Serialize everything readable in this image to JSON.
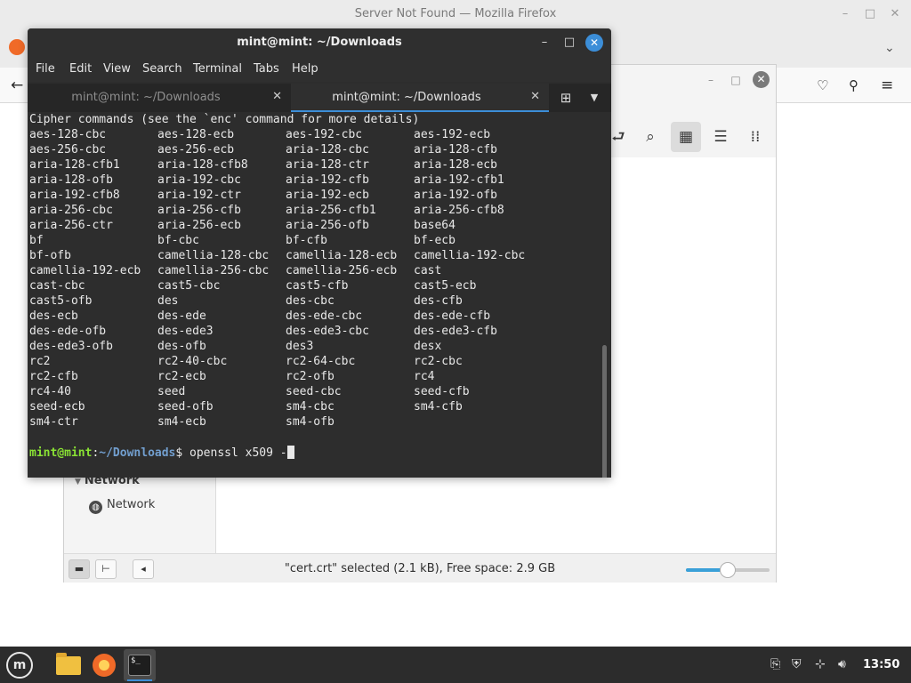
{
  "firefox": {
    "window_title": "Server Not Found — Mozilla Firefox",
    "titlebar_buttons": [
      "–",
      "□",
      "✕"
    ]
  },
  "file_manager": {
    "sidebar_section": "Network",
    "sidebar_item": "Network",
    "status_text": "\"cert.crt\" selected (2.1 kB), Free space: 2.9 GB",
    "zoom_level": 0.5
  },
  "terminal": {
    "window_title": "mint@mint: ~/Downloads",
    "menu": [
      "File",
      "Edit",
      "View",
      "Search",
      "Terminal",
      "Tabs",
      "Help"
    ],
    "tabs": [
      {
        "label": "mint@mint: ~/Downloads",
        "active": false
      },
      {
        "label": "mint@mint: ~/Downloads",
        "active": true
      }
    ],
    "header_line": "Cipher commands (see the `enc' command for more details)",
    "ciphers": [
      [
        "aes-128-cbc",
        "aes-128-ecb",
        "aes-192-cbc",
        "aes-192-ecb"
      ],
      [
        "aes-256-cbc",
        "aes-256-ecb",
        "aria-128-cbc",
        "aria-128-cfb"
      ],
      [
        "aria-128-cfb1",
        "aria-128-cfb8",
        "aria-128-ctr",
        "aria-128-ecb"
      ],
      [
        "aria-128-ofb",
        "aria-192-cbc",
        "aria-192-cfb",
        "aria-192-cfb1"
      ],
      [
        "aria-192-cfb8",
        "aria-192-ctr",
        "aria-192-ecb",
        "aria-192-ofb"
      ],
      [
        "aria-256-cbc",
        "aria-256-cfb",
        "aria-256-cfb1",
        "aria-256-cfb8"
      ],
      [
        "aria-256-ctr",
        "aria-256-ecb",
        "aria-256-ofb",
        "base64"
      ],
      [
        "bf",
        "bf-cbc",
        "bf-cfb",
        "bf-ecb"
      ],
      [
        "bf-ofb",
        "camellia-128-cbc",
        "camellia-128-ecb",
        "camellia-192-cbc"
      ],
      [
        "camellia-192-ecb",
        "camellia-256-cbc",
        "camellia-256-ecb",
        "cast"
      ],
      [
        "cast-cbc",
        "cast5-cbc",
        "cast5-cfb",
        "cast5-ecb"
      ],
      [
        "cast5-ofb",
        "des",
        "des-cbc",
        "des-cfb"
      ],
      [
        "des-ecb",
        "des-ede",
        "des-ede-cbc",
        "des-ede-cfb"
      ],
      [
        "des-ede-ofb",
        "des-ede3",
        "des-ede3-cbc",
        "des-ede3-cfb"
      ],
      [
        "des-ede3-ofb",
        "des-ofb",
        "des3",
        "desx"
      ],
      [
        "rc2",
        "rc2-40-cbc",
        "rc2-64-cbc",
        "rc2-cbc"
      ],
      [
        "rc2-cfb",
        "rc2-ecb",
        "rc2-ofb",
        "rc4"
      ],
      [
        "rc4-40",
        "seed",
        "seed-cbc",
        "seed-cfb"
      ],
      [
        "seed-ecb",
        "seed-ofb",
        "sm4-cbc",
        "sm4-cfb"
      ],
      [
        "sm4-ctr",
        "sm4-ecb",
        "sm4-ofb",
        ""
      ]
    ],
    "prompt_user": "mint@mint",
    "prompt_sep": ":",
    "prompt_path": "~/Downloads",
    "prompt_symbol": "$",
    "command": " openssl x509 -"
  },
  "taskbar": {
    "clock": "13:50",
    "menu_icon": "mint-logo",
    "apps": [
      "folder-icon",
      "firefox-icon",
      "terminal-icon"
    ],
    "terminal_glyph": "$_"
  }
}
